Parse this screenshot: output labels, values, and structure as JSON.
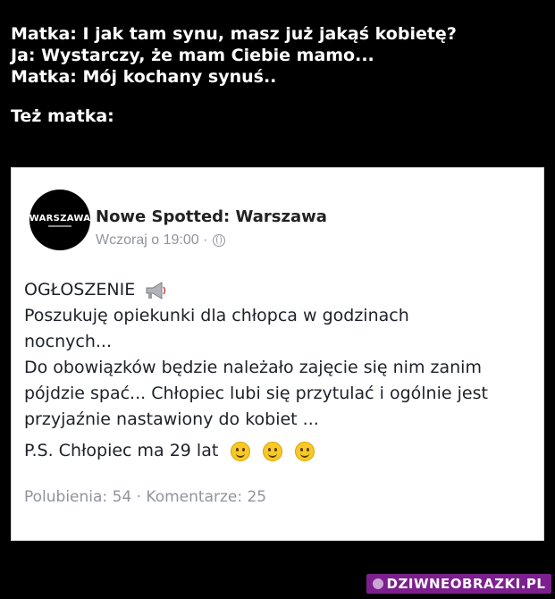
{
  "header": {
    "lines": [
      "Matka: I jak tam synu, masz już jakąś kobietę?",
      "Ja: Wystarczy, że mam Ciebie mamo...",
      "Matka: Mój kochany synuś.."
    ],
    "caption": "Też matka:"
  },
  "post": {
    "avatar_text": "WARSZAWA",
    "page_name": "Nowe Spotted: Warszawa",
    "timestamp": "Wczoraj o 19:00 ·",
    "privacy_icon": "globe-icon",
    "title": "OGŁOSZENIE",
    "title_icon": "megaphone-icon",
    "body_lines": [
      "Poszukuję opiekunki dla chłopca w godzinach",
      "nocnych...",
      "Do obowiązków będzie należało zajęcie się nim zanim",
      "pójdzie spać... Chłopiec lubi się przytulać i ogólnie jest",
      "przyjaźnie nastawiony do kobiet ..."
    ],
    "ps": "P.S. Chłopiec ma 29 lat",
    "emoji_icon": "smile-emoji-icon",
    "stats": "Polubienia: 54 · Komentarze: 25"
  },
  "watermark": {
    "text": "DZIWNEOBRAZKI.PL",
    "color": "#7d1f8e"
  }
}
